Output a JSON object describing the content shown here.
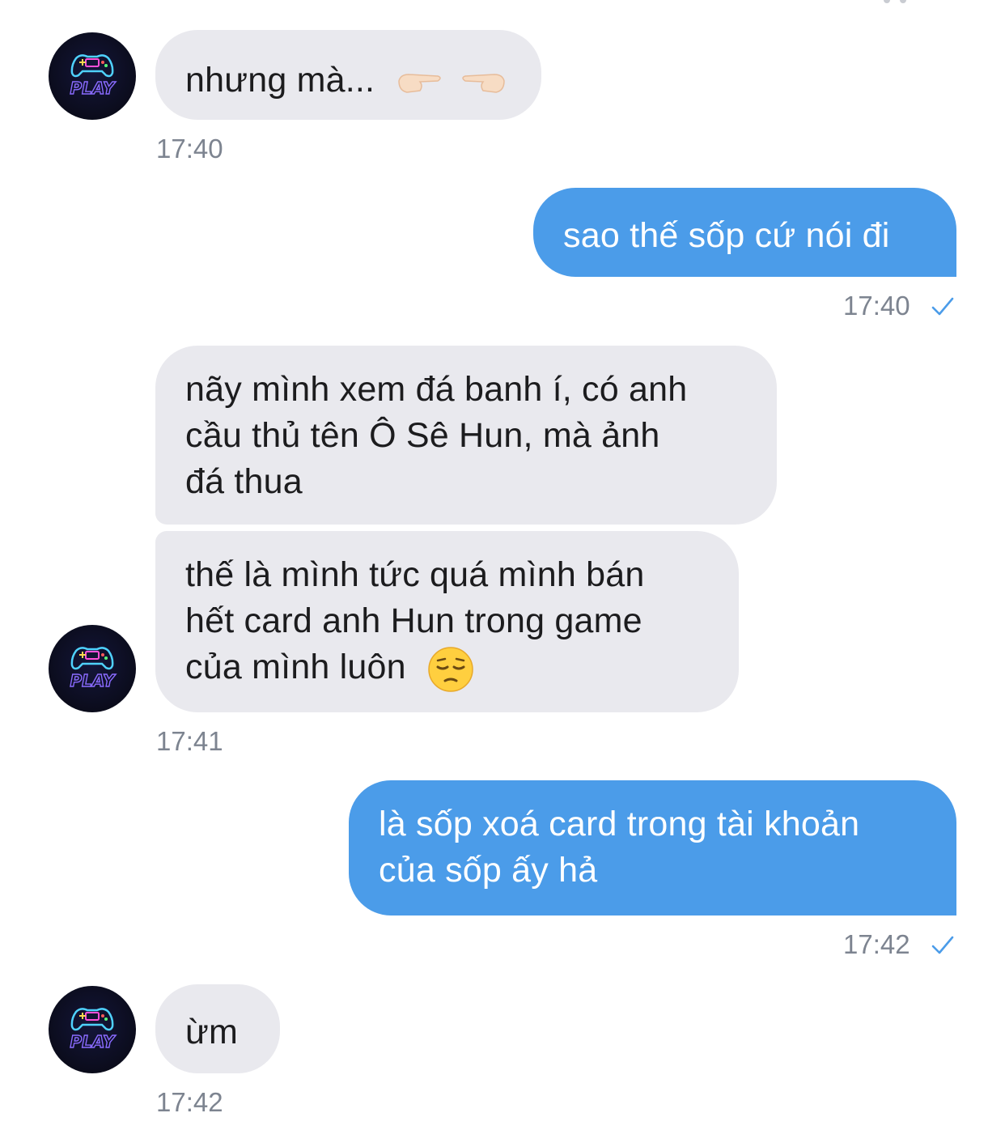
{
  "messages": [
    {
      "from": "contact",
      "lines": [
        "nhưng mà..."
      ],
      "emojis": [
        "backhand-index-pointing-right",
        "backhand-index-pointing-left"
      ],
      "time": "17:40"
    },
    {
      "from": "me",
      "lines": [
        "sao thế sốp cứ nói đi"
      ],
      "time": "17:40"
    },
    {
      "from": "contact",
      "lines": [
        "nãy mình xem đá banh í, có anh",
        "cầu thủ tên Ô Sê Hun, mà ảnh",
        "đá thua"
      ]
    },
    {
      "from": "contact",
      "lines": [
        "thế là mình tức quá mình bán",
        "hết card anh Hun trong game",
        "của mình luôn"
      ],
      "emojis": [
        "pensive-face"
      ],
      "time": "17:41"
    },
    {
      "from": "me",
      "lines": [
        "là sốp xoá card trong tài khoản",
        "của sốp ấy hả"
      ],
      "time": "17:42"
    },
    {
      "from": "contact",
      "lines": [
        "ừm"
      ],
      "time": "17:42"
    }
  ],
  "avatar": {
    "icon": "neon-gamepad-play-icon",
    "text": "PLAY"
  },
  "colors": {
    "incoming_bubble": "#e9e9ee",
    "outgoing_bubble": "#4b9ce9",
    "timestamp": "#7d8490",
    "read_check": "#4b9ce9"
  }
}
